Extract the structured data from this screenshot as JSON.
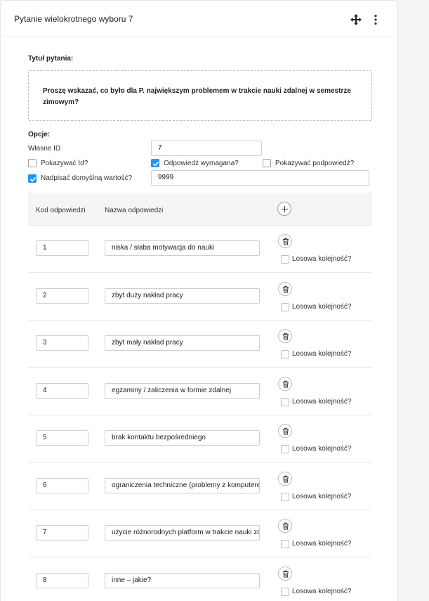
{
  "card": {
    "title": "Pytanie wielokrotnego wyboru 7"
  },
  "icons": {
    "move": "move-arrows-icon",
    "menu": "more-vert-icon",
    "add": "plus-icon",
    "delete": "trash-icon"
  },
  "question": {
    "label": "Tytuł pytania:",
    "text": "Proszę wskazać, co było dla P. największym problemem w trakcie nauki zdalnej w semestrze zimowym?"
  },
  "options": {
    "label": "Opcje:",
    "own_id_label": "Własne ID",
    "own_id_value": "7",
    "show_id_label": "Pokazywać Id?",
    "show_id_checked": false,
    "required_label": "Odpowiedź wymagana?",
    "required_checked": true,
    "show_hint_label": "Pokazywać podpowiedź?",
    "show_hint_checked": false,
    "override_default_label": "Nadpisać domyślną wartość?",
    "override_default_checked": true,
    "default_value": "9999"
  },
  "table": {
    "col_code": "Kod odpowiedzi",
    "col_name": "Nazwa odpowiedzi",
    "random_order_label": "Losowa kolejność?",
    "rows": [
      {
        "code": "1",
        "name": "niska / słaba motywacja do nauki"
      },
      {
        "code": "2",
        "name": "zbyt duży nakład pracy"
      },
      {
        "code": "3",
        "name": "zbyt mały nakład pracy"
      },
      {
        "code": "4",
        "name": "egzaminy / zaliczenia w formie zdalnej"
      },
      {
        "code": "5",
        "name": "brak kontaktu bezpośredniego"
      },
      {
        "code": "6",
        "name": "ograniczenia techniczne (problemy z komputerem"
      },
      {
        "code": "7",
        "name": "użycie różnorodnych platform w trakcie nauki zdalnej"
      },
      {
        "code": "8",
        "name": "inne – jakie?"
      }
    ]
  },
  "colors": {
    "accent": "#2196f3",
    "border": "#cfcfcf",
    "header_bg": "#f5f5f5"
  }
}
